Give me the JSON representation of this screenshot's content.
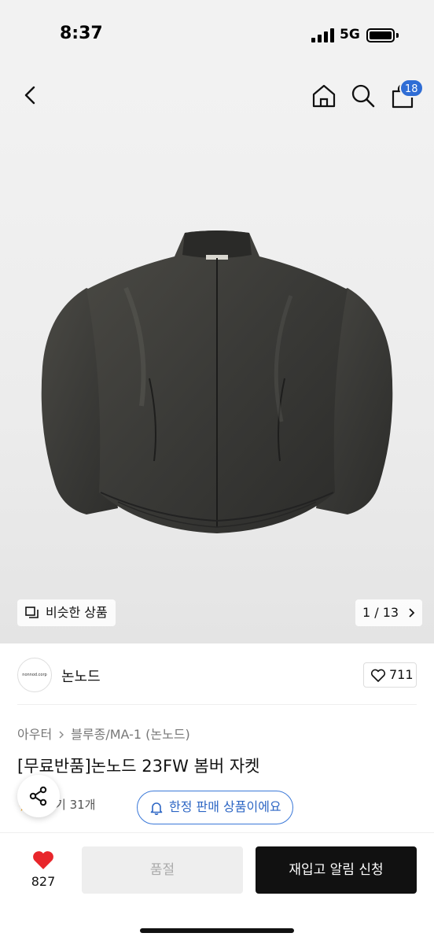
{
  "status_bar": {
    "time": "8:37",
    "network": "5G",
    "icons": [
      "signal-icon",
      "battery-icon"
    ]
  },
  "header": {
    "icons": [
      "back-arrow-icon",
      "home-icon",
      "search-icon",
      "shopping-bag-icon"
    ],
    "cart_badge": "18",
    "badge_color": "#2f6dd5"
  },
  "gallery": {
    "similar_label": "비슷한 상품",
    "pager": "1 / 13",
    "product_color": "#3a3a37"
  },
  "brand": {
    "logo_text": "nonnod.corp",
    "name": "논노드",
    "likes": "711"
  },
  "breadcrumb": {
    "category": "아우터",
    "subcategory": "블루종/MA-1 (논노드)"
  },
  "product": {
    "title": "[무료반품]논노드 23FW 봄버 자켓"
  },
  "review": {
    "text": "기 31개"
  },
  "limited_pill": {
    "label": "한정 판매 상품이에요",
    "accent": "#3a78d8"
  },
  "bottom_bar": {
    "like_count": "827",
    "soldout_label": "품절",
    "restock_label": "재입고 알림 신청",
    "heart_color": "#e8262b"
  }
}
